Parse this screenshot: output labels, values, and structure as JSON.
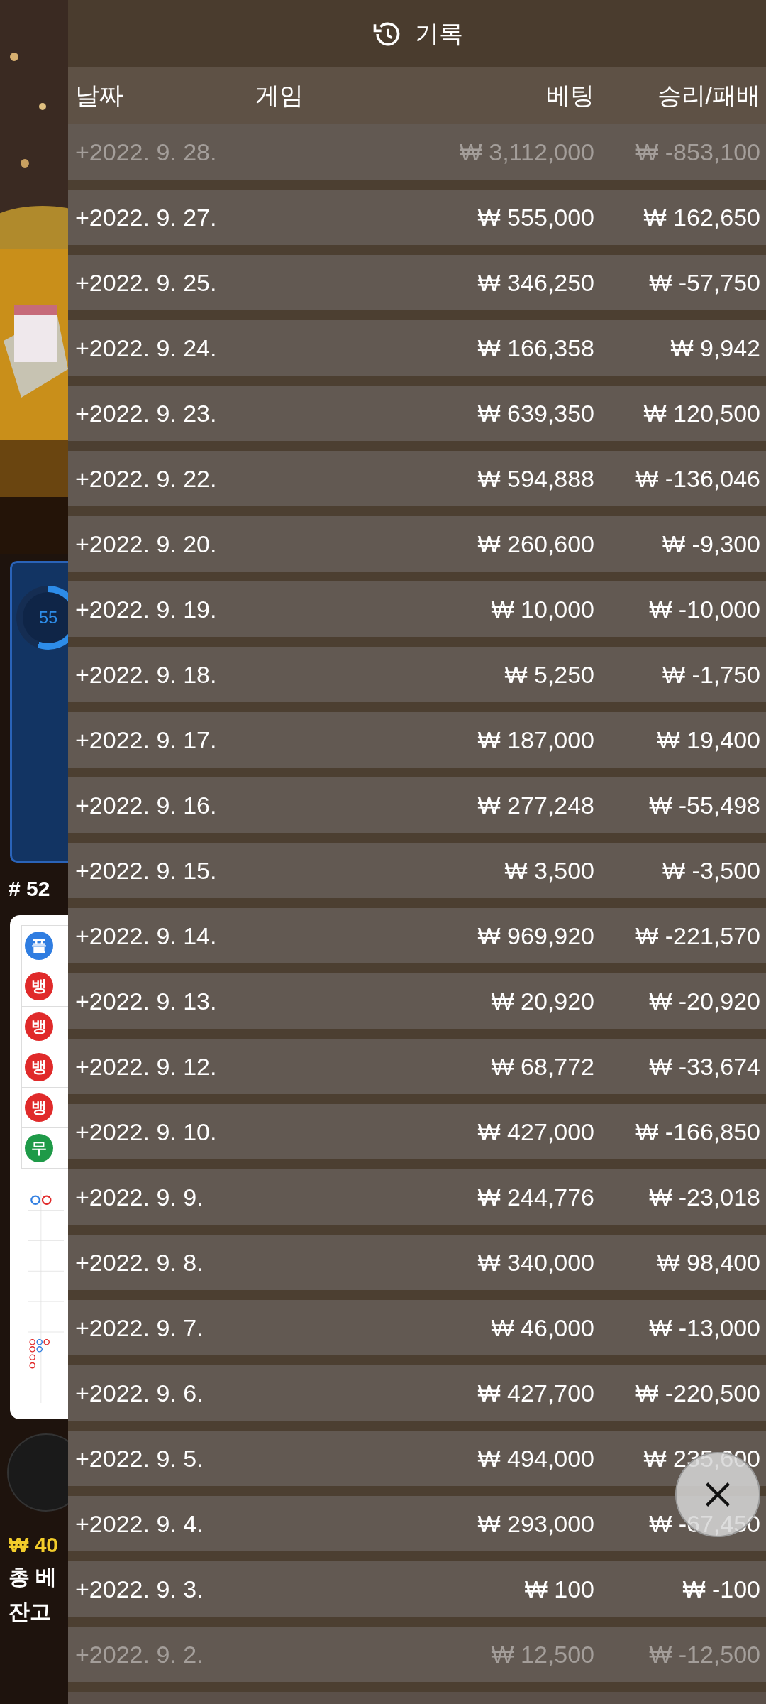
{
  "side": {
    "progress": {
      "label": "55"
    },
    "round": "# 52",
    "road": [
      {
        "label": "플",
        "color": "#2f7de1"
      },
      {
        "label": "뱅",
        "color": "#e02a2a"
      },
      {
        "label": "뱅",
        "color": "#e02a2a"
      },
      {
        "label": "뱅",
        "color": "#e02a2a"
      },
      {
        "label": "뱅",
        "color": "#e02a2a"
      },
      {
        "label": "무",
        "color": "#1e9a48"
      }
    ],
    "amount": "₩ 40",
    "total_bet": "총 베",
    "balance_label": "잔고"
  },
  "history": {
    "title": "기록",
    "columns": [
      "날짜",
      "게임",
      "베팅",
      "승리/패배"
    ],
    "rows": [
      {
        "date": "+2022. 9. 28.",
        "bet": "₩ 3,112,000",
        "result": "₩ -853,100",
        "faded": true
      },
      {
        "date": "+2022. 9. 27.",
        "bet": "₩ 555,000",
        "result": "₩ 162,650",
        "faded": false
      },
      {
        "date": "+2022. 9. 25.",
        "bet": "₩ 346,250",
        "result": "₩ -57,750",
        "faded": false
      },
      {
        "date": "+2022. 9. 24.",
        "bet": "₩ 166,358",
        "result": "₩ 9,942",
        "faded": false
      },
      {
        "date": "+2022. 9. 23.",
        "bet": "₩ 639,350",
        "result": "₩ 120,500",
        "faded": false
      },
      {
        "date": "+2022. 9. 22.",
        "bet": "₩ 594,888",
        "result": "₩ -136,046",
        "faded": false
      },
      {
        "date": "+2022. 9. 20.",
        "bet": "₩ 260,600",
        "result": "₩ -9,300",
        "faded": false
      },
      {
        "date": "+2022. 9. 19.",
        "bet": "₩ 10,000",
        "result": "₩ -10,000",
        "faded": false
      },
      {
        "date": "+2022. 9. 18.",
        "bet": "₩ 5,250",
        "result": "₩ -1,750",
        "faded": false
      },
      {
        "date": "+2022. 9. 17.",
        "bet": "₩ 187,000",
        "result": "₩ 19,400",
        "faded": false
      },
      {
        "date": "+2022. 9. 16.",
        "bet": "₩ 277,248",
        "result": "₩ -55,498",
        "faded": false
      },
      {
        "date": "+2022. 9. 15.",
        "bet": "₩ 3,500",
        "result": "₩ -3,500",
        "faded": false
      },
      {
        "date": "+2022. 9. 14.",
        "bet": "₩ 969,920",
        "result": "₩ -221,570",
        "faded": false
      },
      {
        "date": "+2022. 9. 13.",
        "bet": "₩ 20,920",
        "result": "₩ -20,920",
        "faded": false
      },
      {
        "date": "+2022. 9. 12.",
        "bet": "₩ 68,772",
        "result": "₩ -33,674",
        "faded": false
      },
      {
        "date": "+2022. 9. 10.",
        "bet": "₩ 427,000",
        "result": "₩ -166,850",
        "faded": false
      },
      {
        "date": "+2022. 9. 9.",
        "bet": "₩ 244,776",
        "result": "₩ -23,018",
        "faded": false
      },
      {
        "date": "+2022. 9. 8.",
        "bet": "₩ 340,000",
        "result": "₩ 98,400",
        "faded": false
      },
      {
        "date": "+2022. 9. 7.",
        "bet": "₩ 46,000",
        "result": "₩ -13,000",
        "faded": false
      },
      {
        "date": "+2022. 9. 6.",
        "bet": "₩ 427,700",
        "result": "₩ -220,500",
        "faded": false
      },
      {
        "date": "+2022. 9. 5.",
        "bet": "₩ 494,000",
        "result": "₩ 235,600",
        "faded": false
      },
      {
        "date": "+2022. 9. 4.",
        "bet": "₩ 293,000",
        "result": "₩ -67,450",
        "faded": false
      },
      {
        "date": "+2022. 9. 3.",
        "bet": "₩ 100",
        "result": "₩ -100",
        "faded": false
      },
      {
        "date": "+2022. 9. 2.",
        "bet": "₩ 12,500",
        "result": "₩ -12,500",
        "faded": true
      }
    ]
  }
}
